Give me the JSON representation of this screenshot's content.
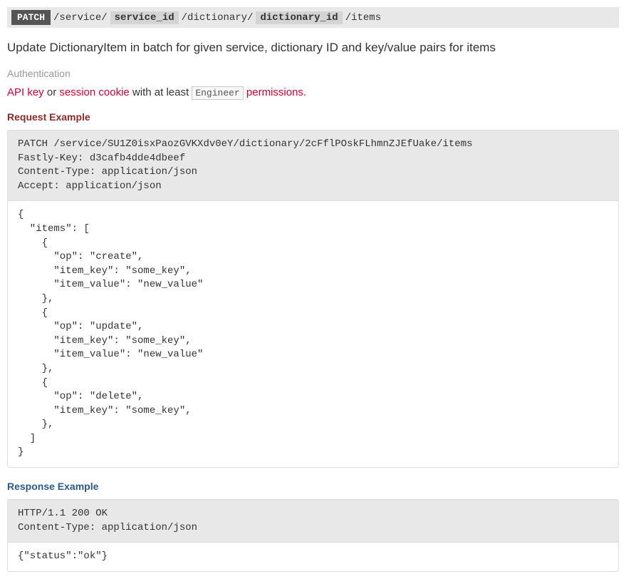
{
  "endpoint": {
    "method": "PATCH",
    "path_parts": [
      {
        "type": "seg",
        "text": "/service/"
      },
      {
        "type": "var",
        "text": "service_id"
      },
      {
        "type": "seg",
        "text": "/dictionary/"
      },
      {
        "type": "var",
        "text": "dictionary_id"
      },
      {
        "type": "seg",
        "text": "/items"
      }
    ]
  },
  "description": "Update DictionaryItem in batch for given service, dictionary ID and key/value pairs for items",
  "auth": {
    "label": "Authentication",
    "prefix": "",
    "api_key": "API key",
    "or": " or ",
    "session_cookie": "session cookie",
    "with": " with at least ",
    "role": "Engineer",
    "permissions": " permissions."
  },
  "request": {
    "label": "Request Example",
    "headers": "PATCH /service/SU1Z0isxPaozGVKXdv0eY/dictionary/2cFflPOskFLhmnZJEfUake/items\nFastly-Key: d3cafb4dde4dbeef\nContent-Type: application/json\nAccept: application/json",
    "body": "{\n  \"items\": [\n    {\n      \"op\": \"create\",\n      \"item_key\": \"some_key\",\n      \"item_value\": \"new_value\"\n    },\n    {\n      \"op\": \"update\",\n      \"item_key\": \"some_key\",\n      \"item_value\": \"new_value\"\n    },\n    {\n      \"op\": \"delete\",\n      \"item_key\": \"some_key\",\n    },\n  ]\n}"
  },
  "response": {
    "label": "Response Example",
    "headers": "HTTP/1.1 200 OK\nContent-Type: application/json",
    "body": "{\"status\":\"ok\"}"
  }
}
